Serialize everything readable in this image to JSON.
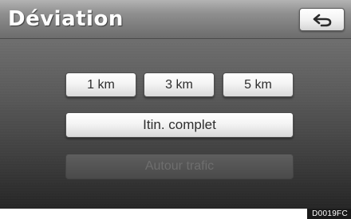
{
  "header": {
    "title": "Déviation",
    "back_icon": "return-arrow-icon"
  },
  "distance_options": [
    {
      "label": "1 km"
    },
    {
      "label": "3 km"
    },
    {
      "label": "5 km"
    }
  ],
  "route_options": {
    "full_route_label": "Itin. complet",
    "around_traffic_label": "Autour trafic"
  },
  "footer": {
    "image_code": "D0019FC"
  },
  "colors": {
    "header_text": "#ffffff",
    "button_face": "#f4f4f4",
    "button_text": "#2d2d2d",
    "disabled_button_face": "#545454",
    "disabled_button_text": "#6e6e6e"
  }
}
